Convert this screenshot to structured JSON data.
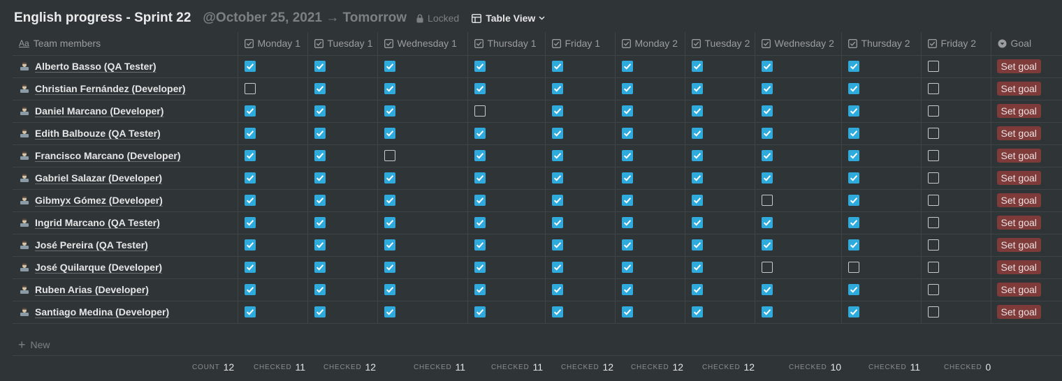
{
  "page": {
    "title": "English progress - Sprint 22",
    "date_range": "@October 25, 2021 → Tomorrow",
    "locked_label": "Locked",
    "view_label": "Table View"
  },
  "table": {
    "name_header": "Team members",
    "goal_header": "Goal",
    "goal_label": "Set goal",
    "new_label": "New",
    "days": [
      "Monday 1",
      "Tuesday 1",
      "Wednesday 1",
      "Thursday 1",
      "Friday 1",
      "Monday 2",
      "Tuesday 2",
      "Wednesday 2",
      "Thursday 2",
      "Friday 2"
    ],
    "rows": [
      {
        "name": "Alberto Basso (QA Tester)",
        "checks": [
          1,
          1,
          1,
          1,
          1,
          1,
          1,
          1,
          1,
          0
        ]
      },
      {
        "name": "Christian Fernández (Developer)",
        "checks": [
          0,
          1,
          1,
          1,
          1,
          1,
          1,
          1,
          1,
          0
        ]
      },
      {
        "name": "Daniel Marcano (Developer)",
        "checks": [
          1,
          1,
          1,
          0,
          1,
          1,
          1,
          1,
          1,
          0
        ]
      },
      {
        "name": "Edith Balbouze (QA Tester)",
        "checks": [
          1,
          1,
          1,
          1,
          1,
          1,
          1,
          1,
          1,
          0
        ]
      },
      {
        "name": "Francisco Marcano (Developer)",
        "checks": [
          1,
          1,
          0,
          1,
          1,
          1,
          1,
          1,
          1,
          0
        ]
      },
      {
        "name": "Gabriel Salazar (Developer)",
        "checks": [
          1,
          1,
          1,
          1,
          1,
          1,
          1,
          1,
          1,
          0
        ]
      },
      {
        "name": "Gibmyx Gómez (Developer)",
        "checks": [
          1,
          1,
          1,
          1,
          1,
          1,
          1,
          0,
          1,
          0
        ]
      },
      {
        "name": "Ingrid Marcano (QA Tester)",
        "checks": [
          1,
          1,
          1,
          1,
          1,
          1,
          1,
          1,
          1,
          0
        ]
      },
      {
        "name": "José Pereira (QA Tester)",
        "checks": [
          1,
          1,
          1,
          1,
          1,
          1,
          1,
          1,
          1,
          0
        ]
      },
      {
        "name": "José Quilarque (Developer)",
        "checks": [
          1,
          1,
          1,
          1,
          1,
          1,
          1,
          0,
          0,
          0
        ]
      },
      {
        "name": "Ruben Arias (Developer)",
        "checks": [
          1,
          1,
          1,
          1,
          1,
          1,
          1,
          1,
          1,
          0
        ]
      },
      {
        "name": "Santiago Medina (Developer)",
        "checks": [
          1,
          1,
          1,
          1,
          1,
          1,
          1,
          1,
          1,
          0
        ]
      }
    ]
  },
  "footer": {
    "count_label": "COUNT",
    "count_value": "12",
    "checked_label": "CHECKED",
    "checked_values": [
      "11",
      "12",
      "11",
      "11",
      "12",
      "12",
      "12",
      "10",
      "11",
      "0"
    ]
  },
  "colors": {
    "background": "#2f3437",
    "checkbox_checked": "#2eaadc",
    "goal_pill": "#7f3a3a"
  }
}
